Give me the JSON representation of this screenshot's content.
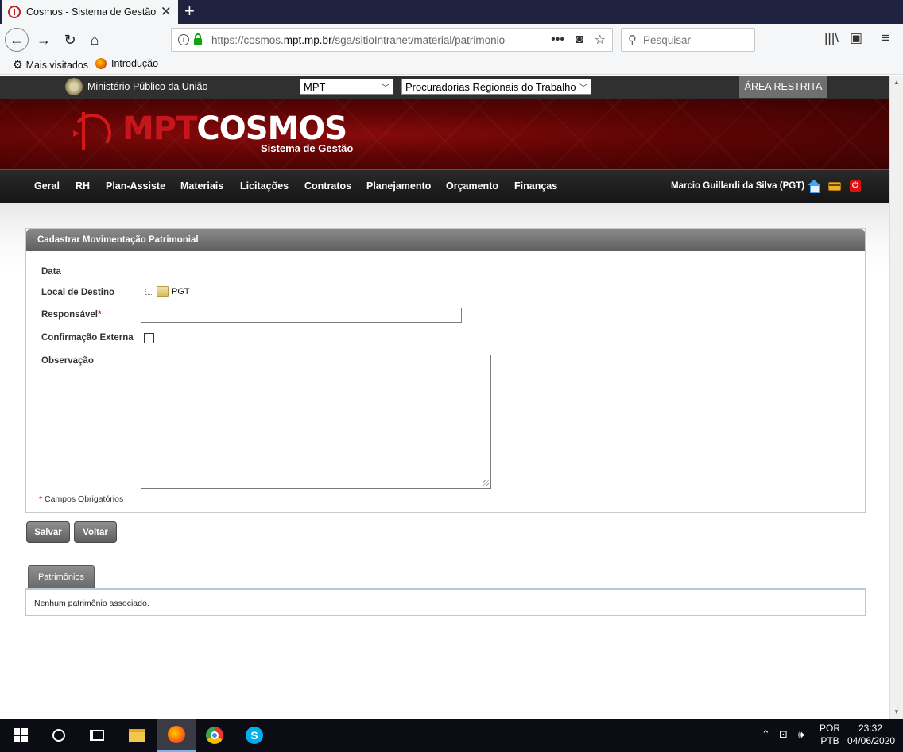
{
  "browser": {
    "tab_title": "Cosmos - Sistema de Gestão",
    "url_prefix": "https://cosmos.",
    "url_domain": "mpt.mp.br",
    "url_path": "/sga/sitioIntranet/material/patrimonio",
    "search_placeholder": "Pesquisar",
    "bookmarks": [
      "Mais visitados",
      "Introdução"
    ]
  },
  "topbar": {
    "org_name": "Ministério Público da União",
    "select_org": "MPT",
    "select_unit": "Procuradorias Regionais do Trabalho",
    "restricted_label": "ÁREA RESTRITA"
  },
  "banner": {
    "logo_mpt": "MPT",
    "logo_cosmos": "COSMOS",
    "tagline": "Sistema de Gestão"
  },
  "menu": {
    "items": [
      "Geral",
      "RH",
      "Plan-Assiste",
      "Materiais",
      "Licitações",
      "Contratos",
      "Planejamento",
      "Orçamento",
      "Finanças"
    ],
    "user": "Marcio Guillardi da Silva (PGT)"
  },
  "form": {
    "title": "Cadastrar Movimentação Patrimonial",
    "label_data": "Data",
    "label_local": "Local de Destino",
    "local_value": "PGT",
    "label_responsavel": "Responsável",
    "required_mark": "*",
    "responsavel_value": "",
    "label_confirmacao": "Confirmação Externa",
    "confirmacao_checked": false,
    "label_observacao": "Observação",
    "observacao_value": "",
    "required_note": "Campos Obrigatórios"
  },
  "actions": {
    "save": "Salvar",
    "back": "Voltar"
  },
  "patrimonios": {
    "tab_label": "Patrimônios",
    "empty_message": "Nenhum patrimônio associado."
  },
  "taskbar": {
    "lang_1": "POR",
    "lang_2": "PTB",
    "time": "23:32",
    "date": "04/06/2020"
  }
}
